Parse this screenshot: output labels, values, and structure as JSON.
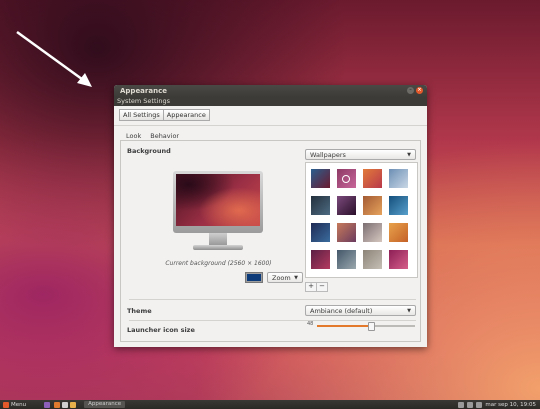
{
  "window": {
    "title": "Appearance",
    "menubar": "System Settings",
    "breadcrumbs": [
      "All Settings",
      "Appearance"
    ],
    "tabs": [
      "Look",
      "Behavior"
    ],
    "active_tab": "Look"
  },
  "look": {
    "background_label": "Background",
    "caption": "Current background (2560 × 1600)",
    "wallpaper_source": "Wallpapers",
    "zoom_mode": "Zoom",
    "add_label": "+",
    "remove_label": "−",
    "theme_label": "Theme",
    "theme_value": "Ambiance (default)",
    "launcher_label": "Launcher icon size",
    "launcher_value": "48",
    "launcher_fraction": 0.55,
    "swatch_color": "#0c3a78"
  },
  "wallpapers": [
    {
      "c1": "#2a5f8f",
      "c2": "#6b1a2e",
      "selected": false
    },
    {
      "c1": "#8e3a66",
      "c2": "#c7669a",
      "selected": true
    },
    {
      "c1": "#e27b3b",
      "c2": "#b8384a",
      "selected": false
    },
    {
      "c1": "#6c8fb4",
      "c2": "#c9d7e6",
      "selected": false
    },
    {
      "c1": "#23303d",
      "c2": "#4d6b82",
      "selected": false
    },
    {
      "c1": "#7b4a7b",
      "c2": "#2a0f2a",
      "selected": false
    },
    {
      "c1": "#a35a33",
      "c2": "#e6a35c",
      "selected": false
    },
    {
      "c1": "#154f7d",
      "c2": "#58a0cc",
      "selected": false
    },
    {
      "c1": "#1e2b54",
      "c2": "#3a6c9e",
      "selected": false
    },
    {
      "c1": "#c77a5b",
      "c2": "#6b3b5e",
      "selected": false
    },
    {
      "c1": "#7c6f73",
      "c2": "#d5c7bf",
      "selected": false
    },
    {
      "c1": "#e8a24b",
      "c2": "#c46127",
      "selected": false
    },
    {
      "c1": "#5b1f44",
      "c2": "#b43a5f",
      "selected": false
    },
    {
      "c1": "#43576a",
      "c2": "#9aa7ad",
      "selected": false
    },
    {
      "c1": "#8d8478",
      "c2": "#c5bfb6",
      "selected": false
    },
    {
      "c1": "#8c1f56",
      "c2": "#d65f8a",
      "selected": false
    }
  ],
  "taskbar": {
    "menu_label": "Menu",
    "window_button": "Appearance",
    "clock": "mar sep 10, 19:05"
  }
}
